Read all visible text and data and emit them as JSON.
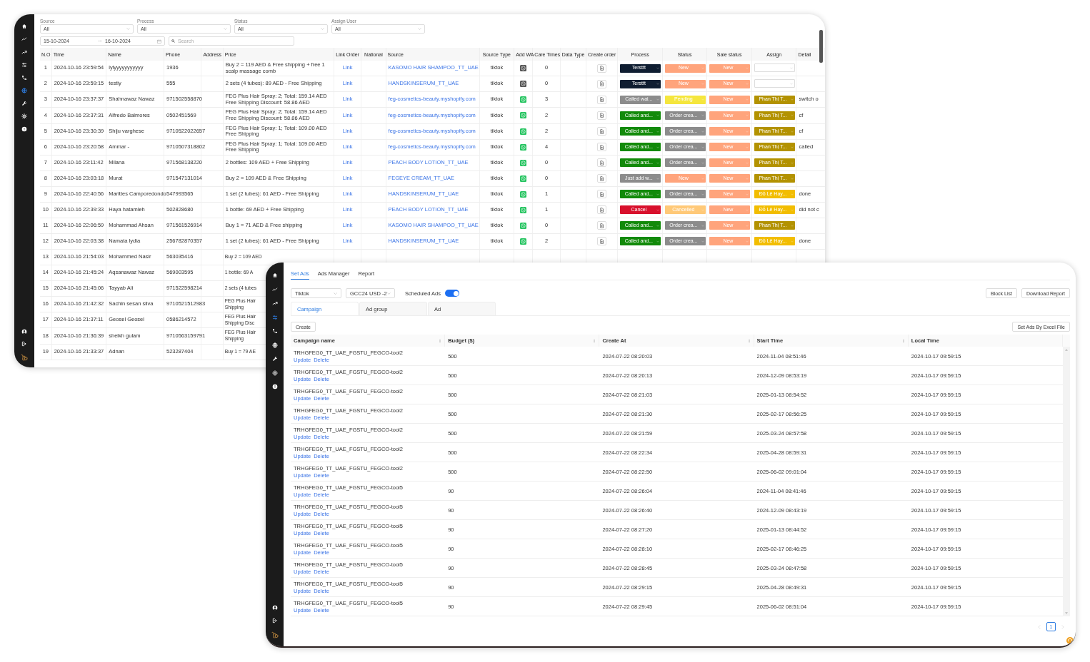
{
  "back_window": {
    "sidebar": {
      "items": [
        {
          "selected": false
        },
        {
          "selected": false
        },
        {
          "selected": false
        },
        {
          "selected": false
        },
        {
          "selected": false
        },
        {
          "selected": true
        },
        {
          "selected": false
        },
        {
          "selected": false
        },
        {
          "selected": false
        }
      ]
    },
    "filters": [
      {
        "label": "Source",
        "value": "All"
      },
      {
        "label": "Process",
        "value": "All"
      },
      {
        "label": "Status",
        "value": "All"
      },
      {
        "label": "Assign User",
        "value": "All"
      }
    ],
    "date_range": {
      "start": "15-10-2024",
      "end": "16-10-2024"
    },
    "search": {
      "placeholder": "Search"
    },
    "table": {
      "columns": [
        "N.O",
        "Time",
        "Name",
        "Phone",
        "Address",
        "Price",
        "Link Order",
        "National",
        "Source",
        "Source Type",
        "Add WA",
        "Care Times",
        "Data Type",
        "Create order",
        "Process",
        "Status",
        "Sale status",
        "Assign",
        "Detail"
      ],
      "rows": [
        {
          "no": "1",
          "time": "2024-10-16 23:59:54",
          "name": "lylyyyyyyyyyyy",
          "phone": "1936",
          "price": "Buy 2 = 119 AED & Free shipping + free 1 scalp massage comb",
          "link": "Link",
          "source": "KASOMO HAIR SHAMPOO_TT_UAE",
          "source_type": "tiktok",
          "wa": {
            "color": "#555555"
          },
          "care_times": "0",
          "process": {
            "label": "Tersttt",
            "color": "#0f1d31"
          },
          "status": {
            "label": "New",
            "color": "#ffa47c"
          },
          "sale_status": {
            "label": "New",
            "color": "#ffa47c"
          }
        },
        {
          "no": "2",
          "time": "2024-10-16 23:59:15",
          "name": "testiy",
          "phone": "555",
          "price": "2 sets (4 tubes): 89 AED - Free Shipping",
          "link": "Link",
          "source": "HANDSKINSERUM_TT_UAE",
          "source_type": "tiktok",
          "wa": {
            "color": "#555555"
          },
          "care_times": "0",
          "process": {
            "label": "Tersttt",
            "color": "#0f1d31"
          },
          "status": {
            "label": "New",
            "color": "#ffa47c"
          },
          "sale_status": {
            "label": "New",
            "color": "#ffa47c"
          }
        },
        {
          "no": "3",
          "time": "2024-10-16 23:37:37",
          "name": "Shahnawaz Nawaz",
          "phone": "971502558870",
          "price": "FEG Plus Hair Spray: 2; Total: 159.14 AED Free Shipping Discount: 58.86 AED",
          "link": "Link",
          "source": "feg-cosmetics-beauty.myshopify.com",
          "source_type": "tiktok",
          "wa": {
            "color": "#25c460"
          },
          "care_times": "3",
          "process": {
            "label": "Called wai...",
            "color": "#8c8c8c"
          },
          "status": {
            "label": "Pending",
            "color": "#f5e63d"
          },
          "sale_status": {
            "label": "New",
            "color": "#ffa47c"
          },
          "assign": {
            "label": "Phan Thị T...",
            "color": "#b39200"
          },
          "detail": "switch o"
        },
        {
          "no": "4",
          "time": "2024-10-16 23:37:31",
          "name": "Alfredo Balmores",
          "phone": "0502451569",
          "price": "FEG Plus Hair Spray: 2; Total: 159.14 AED Free Shipping Discount: 58.86 AED",
          "link": "Link",
          "source": "feg-cosmetics-beauty.myshopify.com",
          "source_type": "tiktok",
          "wa": {
            "color": "#25c460"
          },
          "care_times": "2",
          "process": {
            "label": "Called and...",
            "color": "#128a0a"
          },
          "status": {
            "label": "Order crea...",
            "color": "#8c8c8c"
          },
          "sale_status": {
            "label": "New",
            "color": "#ffa47c"
          },
          "assign": {
            "label": "Phan Thị T...",
            "color": "#b39200"
          },
          "detail": "cf"
        },
        {
          "no": "5",
          "time": "2024-10-16 23:30:39",
          "name": "Shiju varghese",
          "phone": "9710522022657",
          "price": "FEG Plus Hair Spray: 1; Total: 109.00 AED Free Shipping",
          "link": "Link",
          "source": "feg-cosmetics-beauty.myshopify.com",
          "source_type": "tiktok",
          "wa": {
            "color": "#25c460"
          },
          "care_times": "2",
          "process": {
            "label": "Called and...",
            "color": "#128a0a"
          },
          "status": {
            "label": "Order crea...",
            "color": "#8c8c8c"
          },
          "sale_status": {
            "label": "New",
            "color": "#ffa47c"
          },
          "assign": {
            "label": "Phan Thị T...",
            "color": "#b39200"
          },
          "detail": "cf"
        },
        {
          "no": "6",
          "time": "2024-10-16 23:20:58",
          "name": "Ammar -",
          "phone": "9710507318802",
          "price": "FEG Plus Hair Spray: 1; Total: 109.00 AED Free Shipping",
          "link": "Link",
          "source": "feg-cosmetics-beauty.myshopify.com",
          "source_type": "tiktok",
          "wa": {
            "color": "#25c460"
          },
          "care_times": "4",
          "process": {
            "label": "Called and...",
            "color": "#128a0a"
          },
          "status": {
            "label": "Order crea...",
            "color": "#8c8c8c"
          },
          "sale_status": {
            "label": "New",
            "color": "#ffa47c"
          },
          "assign": {
            "label": "Phan Thị T...",
            "color": "#b39200"
          },
          "detail": "called"
        },
        {
          "no": "7",
          "time": "2024-10-16 23:11:42",
          "name": "Milana",
          "phone": "971568138220",
          "price": "2 bottles: 109 AED + Free Shipping",
          "link": "Link",
          "source": "PEACH BODY LOTION_TT_UAE",
          "source_type": "tiktok",
          "wa": {
            "color": "#25c460"
          },
          "care_times": "0",
          "process": {
            "label": "Called and...",
            "color": "#128a0a"
          },
          "status": {
            "label": "Order crea...",
            "color": "#8c8c8c"
          },
          "sale_status": {
            "label": "New",
            "color": "#ffa47c"
          },
          "assign": {
            "label": "Phan Thị T...",
            "color": "#b39200"
          }
        },
        {
          "no": "8",
          "time": "2024-10-16 23:03:18",
          "name": "Murat",
          "phone": "971547131014",
          "price": "Buy 2 = 109 AED & Free Shipping",
          "link": "Link",
          "source": "FEGEYE CREAM_TT_UAE",
          "source_type": "tiktok",
          "wa": {
            "color": "#25c460"
          },
          "care_times": "0",
          "process": {
            "label": "Just add w...",
            "color": "#8c8c8c"
          },
          "status": {
            "label": "New",
            "color": "#ffa47c"
          },
          "sale_status": {
            "label": "New",
            "color": "#ffa47c"
          },
          "assign": {
            "label": "Phan Thị T...",
            "color": "#b39200"
          }
        },
        {
          "no": "9",
          "time": "2024-10-16 22:40:56",
          "name": "Marittes Camporedondo",
          "phone": "547993565",
          "price": "1 set (2 tubes): 61 AED - Free Shipping",
          "link": "Link",
          "source": "HANDSKINSERUM_TT_UAE",
          "source_type": "tiktok",
          "wa": {
            "color": "#25c460"
          },
          "care_times": "1",
          "process": {
            "label": "Called and...",
            "color": "#128a0a"
          },
          "status": {
            "label": "Order crea...",
            "color": "#8c8c8c"
          },
          "sale_status": {
            "label": "New",
            "color": "#ffa47c"
          },
          "assign": {
            "label": "Đỗ Lê Hay...",
            "color": "#f2bd00"
          },
          "detail": "done"
        },
        {
          "no": "10",
          "time": "2024-10-16 22:39:33",
          "name": "Haya hatamleh",
          "phone": "502828680",
          "price": "1 bottle: 69 AED + Free Shipping",
          "link": "Link",
          "source": "PEACH BODY LOTION_TT_UAE",
          "source_type": "tiktok",
          "wa": {
            "color": "#25c460"
          },
          "care_times": "1",
          "process": {
            "label": "Cancel",
            "color": "#d8102c"
          },
          "status": {
            "label": "Cancelled",
            "color": "#ffc978"
          },
          "sale_status": {
            "label": "New",
            "color": "#ffa47c"
          },
          "assign": {
            "label": "Đỗ Lê Hay...",
            "color": "#f2bd00"
          },
          "detail": "did not c"
        },
        {
          "no": "11",
          "time": "2024-10-16 22:06:59",
          "name": "Mohammad Ahsan",
          "phone": "971561526914",
          "price": "Buy 1 = 71 AED & Free shipping",
          "link": "Link",
          "source": "KASOMO HAIR SHAMPOO_TT_UAE",
          "source_type": "tiktok",
          "wa": {
            "color": "#25c460"
          },
          "care_times": "0",
          "process": {
            "label": "Called and...",
            "color": "#128a0a"
          },
          "status": {
            "label": "Order crea...",
            "color": "#8c8c8c"
          },
          "sale_status": {
            "label": "New",
            "color": "#ffa47c"
          },
          "assign": {
            "label": "Phan Thị T...",
            "color": "#b39200"
          }
        },
        {
          "no": "12",
          "time": "2024-10-16 22:03:38",
          "name": "Namata lydia",
          "phone": "256782870357",
          "price": "1 set (2 tubes): 61 AED - Free Shipping",
          "link": "Link",
          "source": "HANDSKINSERUM_TT_UAE",
          "source_type": "tiktok",
          "wa": {
            "color": "#25c460"
          },
          "care_times": "2",
          "process": {
            "label": "Called and...",
            "color": "#128a0a"
          },
          "status": {
            "label": "Order crea...",
            "color": "#8c8c8c"
          },
          "sale_status": {
            "label": "New",
            "color": "#ffa47c"
          },
          "assign": {
            "label": "Đỗ Lê Hay...",
            "color": "#f2bd00"
          },
          "detail": "done"
        },
        {
          "no": "13",
          "time": "2024-10-16 21:54:03",
          "name": "Mohammed Nasir",
          "phone": "563035416",
          "price": "Buy 2 = 109 AED"
        },
        {
          "no": "14",
          "time": "2024-10-16 21:45:24",
          "name": "Aqsanawaz Nawaz",
          "phone": "569003595",
          "price": "1 bottle: 69 A"
        },
        {
          "no": "15",
          "time": "2024-10-16 21:45:06",
          "name": "Tayyab Ali",
          "phone": "971522598214",
          "price": "2 sets (4 tubes"
        },
        {
          "no": "16",
          "time": "2024-10-16 21:42:32",
          "name": "Sachin sesan silva",
          "phone": "9710521512983",
          "price": "FEG Plus Hair\nShipping"
        },
        {
          "no": "17",
          "time": "2024-10-16 21:37:11",
          "name": "Geosel Geosel",
          "phone": "0586214572",
          "price": "FEG Plus Hair\nShipping Disc"
        },
        {
          "no": "18",
          "time": "2024-10-16 21:36:39",
          "name": "sheikh gulam",
          "phone": "9710563159791",
          "price": "FEG Plus Hair\nShipping"
        },
        {
          "no": "19",
          "time": "2024-10-16 21:33:37",
          "name": "Adnan",
          "phone": "523287404",
          "price": "Buy 1 = 79 AE"
        }
      ]
    }
  },
  "front_window": {
    "sidebar": {
      "items": [
        {
          "selected": false
        },
        {
          "selected": false
        },
        {
          "selected": false
        },
        {
          "selected": true
        },
        {
          "selected": false
        },
        {
          "selected": false
        },
        {
          "selected": false
        },
        {
          "selected": false
        },
        {
          "selected": false
        }
      ]
    },
    "tabs": [
      {
        "label": "Set Ads",
        "selected": true
      },
      {
        "label": "Ads Manager",
        "selected": false
      },
      {
        "label": "Report",
        "selected": false
      }
    ],
    "platform_select": {
      "value": "Tiktok"
    },
    "account_select": {
      "value": "GCC24 USD -2"
    },
    "scheduled_ads": {
      "label": "Scheduled Ads",
      "on": true
    },
    "buttons": [
      "Block List",
      "Download Report"
    ],
    "level_tabs": [
      {
        "label": "Campaign",
        "selected": true
      },
      {
        "label": "Ad group",
        "selected": false
      },
      {
        "label": "Ad",
        "selected": false
      }
    ],
    "create_button": "Create",
    "excel_button": "Set Ads By Excel File",
    "table": {
      "columns": [
        {
          "label": "Campaign name",
          "sortable": true
        },
        {
          "label": "Budget ($)",
          "sortable": true
        },
        {
          "label": "Create At",
          "sortable": true
        },
        {
          "label": "Start Time",
          "sortable": true
        },
        {
          "label": "Local Time",
          "sortable": false
        }
      ],
      "rows": [
        {
          "name": "TRHGFEG0_TT_UAE_FGSTU_FEGCO-tool2",
          "actions": [
            "Update",
            "Delete"
          ],
          "budget": "500",
          "create_at": "2024-07-22 08:20:03",
          "start_time": "2024-11-04 08:51:46",
          "local_time": "2024-10-17 09:59:15"
        },
        {
          "name": "TRHGFEG0_TT_UAE_FGSTU_FEGCO-tool2",
          "actions": [
            "Update",
            "Delete"
          ],
          "budget": "500",
          "create_at": "2024-07-22 08:20:13",
          "start_time": "2024-12-09 08:53:19",
          "local_time": "2024-10-17 09:59:15"
        },
        {
          "name": "TRHGFEG0_TT_UAE_FGSTU_FEGCO-tool2",
          "actions": [
            "Update",
            "Delete"
          ],
          "budget": "500",
          "create_at": "2024-07-22 08:21:03",
          "start_time": "2025-01-13 08:54:52",
          "local_time": "2024-10-17 09:59:15"
        },
        {
          "name": "TRHGFEG0_TT_UAE_FGSTU_FEGCO-tool2",
          "actions": [
            "Update",
            "Delete"
          ],
          "budget": "500",
          "create_at": "2024-07-22 08:21:30",
          "start_time": "2025-02-17 08:56:25",
          "local_time": "2024-10-17 09:59:15"
        },
        {
          "name": "TRHGFEG0_TT_UAE_FGSTU_FEGCO-tool2",
          "actions": [
            "Update",
            "Delete"
          ],
          "budget": "500",
          "create_at": "2024-07-22 08:21:59",
          "start_time": "2025-03-24 08:57:58",
          "local_time": "2024-10-17 09:59:15"
        },
        {
          "name": "TRHGFEG0_TT_UAE_FGSTU_FEGCO-tool2",
          "actions": [
            "Update",
            "Delete"
          ],
          "budget": "500",
          "create_at": "2024-07-22 08:22:34",
          "start_time": "2025-04-28 08:59:31",
          "local_time": "2024-10-17 09:59:15"
        },
        {
          "name": "TRHGFEG0_TT_UAE_FGSTU_FEGCO-tool2",
          "actions": [
            "Update",
            "Delete"
          ],
          "budget": "500",
          "create_at": "2024-07-22 08:22:50",
          "start_time": "2025-06-02 09:01:04",
          "local_time": "2024-10-17 09:59:15"
        },
        {
          "name": "TRHGFEG0_TT_UAE_FGSTU_FEGCO-tool5",
          "actions": [
            "Update",
            "Delete"
          ],
          "budget": "90",
          "create_at": "2024-07-22 08:26:04",
          "start_time": "2024-11-04 08:41:46",
          "local_time": "2024-10-17 09:59:15"
        },
        {
          "name": "TRHGFEG0_TT_UAE_FGSTU_FEGCO-tool5",
          "actions": [
            "Update",
            "Delete"
          ],
          "budget": "90",
          "create_at": "2024-07-22 08:26:40",
          "start_time": "2024-12-09 08:43:19",
          "local_time": "2024-10-17 09:59:15"
        },
        {
          "name": "TRHGFEG0_TT_UAE_FGSTU_FEGCO-tool5",
          "actions": [
            "Update",
            "Delete"
          ],
          "budget": "90",
          "create_at": "2024-07-22 08:27:20",
          "start_time": "2025-01-13 08:44:52",
          "local_time": "2024-10-17 09:59:15"
        },
        {
          "name": "TRHGFEG0_TT_UAE_FGSTU_FEGCO-tool5",
          "actions": [
            "Update",
            "Delete"
          ],
          "budget": "90",
          "create_at": "2024-07-22 08:28:10",
          "start_time": "2025-02-17 08:46:25",
          "local_time": "2024-10-17 09:59:15"
        },
        {
          "name": "TRHGFEG0_TT_UAE_FGSTU_FEGCO-tool5",
          "actions": [
            "Update",
            "Delete"
          ],
          "budget": "90",
          "create_at": "2024-07-22 08:28:45",
          "start_time": "2025-03-24 08:47:58",
          "local_time": "2024-10-17 09:59:15"
        },
        {
          "name": "TRHGFEG0_TT_UAE_FGSTU_FEGCO-tool5",
          "actions": [
            "Update",
            "Delete"
          ],
          "budget": "90",
          "create_at": "2024-07-22 08:29:15",
          "start_time": "2025-04-28 08:49:31",
          "local_time": "2024-10-17 09:59:15"
        },
        {
          "name": "TRHGFEG0_TT_UAE_FGSTU_FEGCO-tool5",
          "actions": [
            "Update",
            "Delete"
          ],
          "budget": "90",
          "create_at": "2024-07-22 08:29:45",
          "start_time": "2025-06-02 08:51:04",
          "local_time": "2024-10-17 09:59:15"
        }
      ]
    },
    "pagination": {
      "pages": [
        {
          "label": "1",
          "selected": true
        }
      ]
    }
  }
}
